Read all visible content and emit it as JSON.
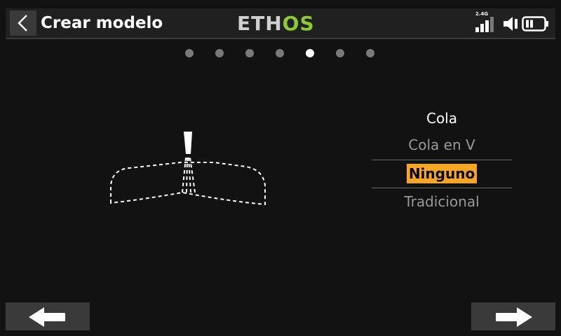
{
  "header": {
    "title": "Crear modelo",
    "logo_left": "ETH",
    "logo_right": "OS",
    "logo_colors": {
      "eth": "#d0d0d0",
      "os": "#8ecb2e"
    },
    "status": {
      "band": "2.4G",
      "icons": [
        "signal-bars-icon",
        "speaker-icon",
        "battery-icon"
      ]
    }
  },
  "pager": {
    "total": 7,
    "current": 5
  },
  "tail_selector": {
    "heading": "Cola",
    "options": [
      "Cola en V",
      "Ninguno",
      "Tradicional"
    ],
    "selected": "Ninguno"
  },
  "footer": {
    "back_icon": "arrow-left-icon",
    "next_icon": "arrow-right-icon"
  },
  "accent_color": "#f7a724"
}
